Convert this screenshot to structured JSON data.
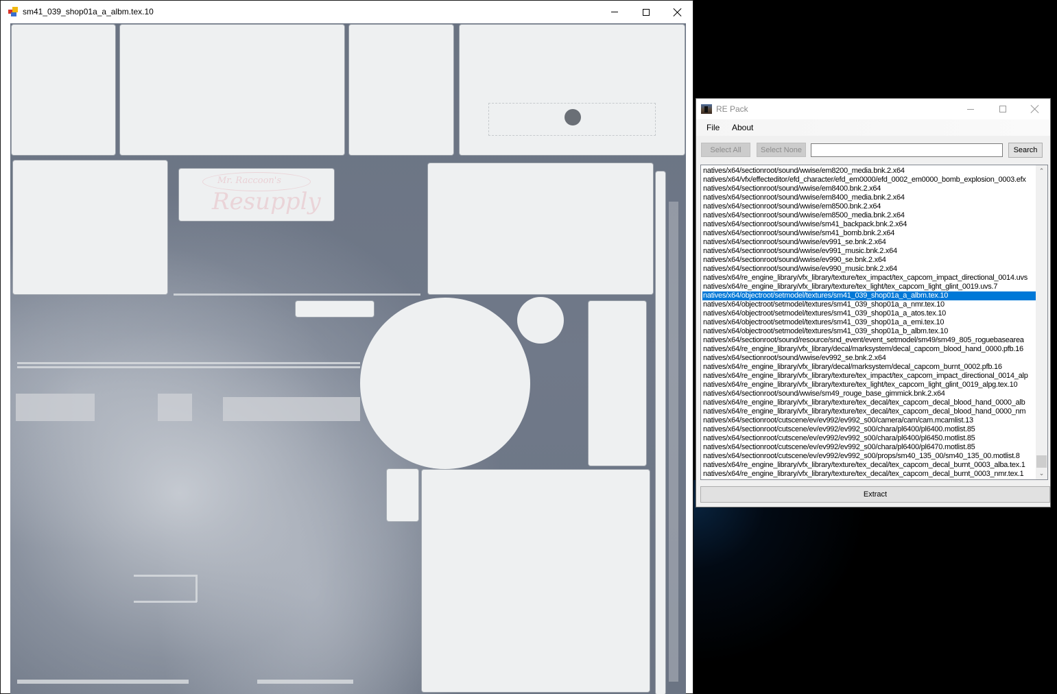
{
  "viewer": {
    "title": "sm41_039_shop01a_a_albm.tex.10",
    "logo_small_text": "Mr. Raccoon's",
    "logo_big_text": "Resupply"
  },
  "repack": {
    "title": "RE Pack",
    "menu": [
      {
        "label": "File"
      },
      {
        "label": "About"
      }
    ],
    "toolbar": {
      "select_all_label": "Select All",
      "select_none_label": "Select None",
      "search_value": "",
      "search_label": "Search"
    },
    "extract_label": "Extract",
    "selected_index": 14,
    "selection_color": "#0078d7",
    "files": [
      "natives/x64/sectionroot/sound/wwise/em8200_media.bnk.2.x64",
      "natives/x64/vfx/effecteditor/efd_character/efd_em0000/efd_0002_em0000_bomb_explosion_0003.efx",
      "natives/x64/sectionroot/sound/wwise/em8400.bnk.2.x64",
      "natives/x64/sectionroot/sound/wwise/em8400_media.bnk.2.x64",
      "natives/x64/sectionroot/sound/wwise/em8500.bnk.2.x64",
      "natives/x64/sectionroot/sound/wwise/em8500_media.bnk.2.x64",
      "natives/x64/sectionroot/sound/wwise/sm41_backpack.bnk.2.x64",
      "natives/x64/sectionroot/sound/wwise/sm41_bomb.bnk.2.x64",
      "natives/x64/sectionroot/sound/wwise/ev991_se.bnk.2.x64",
      "natives/x64/sectionroot/sound/wwise/ev991_music.bnk.2.x64",
      "natives/x64/sectionroot/sound/wwise/ev990_se.bnk.2.x64",
      "natives/x64/sectionroot/sound/wwise/ev990_music.bnk.2.x64",
      "natives/x64/re_engine_library/vfx_library/texture/tex_impact/tex_capcom_impact_directional_0014.uvs",
      "natives/x64/re_engine_library/vfx_library/texture/tex_light/tex_capcom_light_glint_0019.uvs.7",
      "natives/x64/objectroot/setmodel/textures/sm41_039_shop01a_a_albm.tex.10",
      "natives/x64/objectroot/setmodel/textures/sm41_039_shop01a_a_nmr.tex.10",
      "natives/x64/objectroot/setmodel/textures/sm41_039_shop01a_a_atos.tex.10",
      "natives/x64/objectroot/setmodel/textures/sm41_039_shop01a_a_emi.tex.10",
      "natives/x64/objectroot/setmodel/textures/sm41_039_shop01a_b_albm.tex.10",
      "natives/x64/sectionroot/sound/resource/snd_event/event_setmodel/sm49/sm49_805_roguebasearea",
      "natives/x64/re_engine_library/vfx_library/decal/marksystem/decal_capcom_blood_hand_0000.pfb.16",
      "natives/x64/sectionroot/sound/wwise/ev992_se.bnk.2.x64",
      "natives/x64/re_engine_library/vfx_library/decal/marksystem/decal_capcom_burnt_0002.pfb.16",
      "natives/x64/re_engine_library/vfx_library/texture/tex_impact/tex_capcom_impact_directional_0014_alp",
      "natives/x64/re_engine_library/vfx_library/texture/tex_light/tex_capcom_light_glint_0019_alpg.tex.10",
      "natives/x64/sectionroot/sound/wwise/sm49_rouge_base_gimmick.bnk.2.x64",
      "natives/x64/re_engine_library/vfx_library/texture/tex_decal/tex_capcom_decal_blood_hand_0000_alb",
      "natives/x64/re_engine_library/vfx_library/texture/tex_decal/tex_capcom_decal_blood_hand_0000_nm",
      "natives/x64/sectionroot/cutscene/ev/ev992/ev992_s00/camera/cam/cam.mcamlist.13",
      "natives/x64/sectionroot/cutscene/ev/ev992/ev992_s00/chara/pl6400/pl6400.motlist.85",
      "natives/x64/sectionroot/cutscene/ev/ev992/ev992_s00/chara/pl6400/pl6450.motlist.85",
      "natives/x64/sectionroot/cutscene/ev/ev992/ev992_s00/chara/pl6400/pl6470.motlist.85",
      "natives/x64/sectionroot/cutscene/ev/ev992/ev992_s00/props/sm40_135_00/sm40_135_00.motlist.8",
      "natives/x64/re_engine_library/vfx_library/texture/tex_decal/tex_capcom_decal_burnt_0003_alba.tex.1",
      "natives/x64/re_engine_library/vfx_library/texture/tex_decal/tex_capcom_decal_burnt_0003_nmr.tex.1"
    ]
  }
}
